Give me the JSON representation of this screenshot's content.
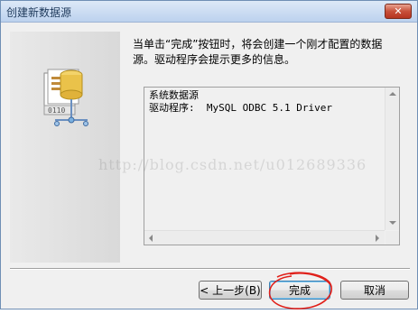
{
  "window": {
    "title": "创建新数据源",
    "close_label": "✕"
  },
  "message": "当单击“完成”按钮时，将会创建一个刚才配置的数据源。驱动程序会提示更多的信息。",
  "info": {
    "line1": "系统数据源",
    "line2": "驱动程序:  MySQL ODBC 5.1 Driver"
  },
  "watermark": "http://blog.csdn.net/u012689336",
  "buttons": {
    "back": "< 上一步(B)",
    "finish": "完成",
    "cancel": "取消"
  },
  "illustration_labels": {
    "digits": "0110"
  }
}
